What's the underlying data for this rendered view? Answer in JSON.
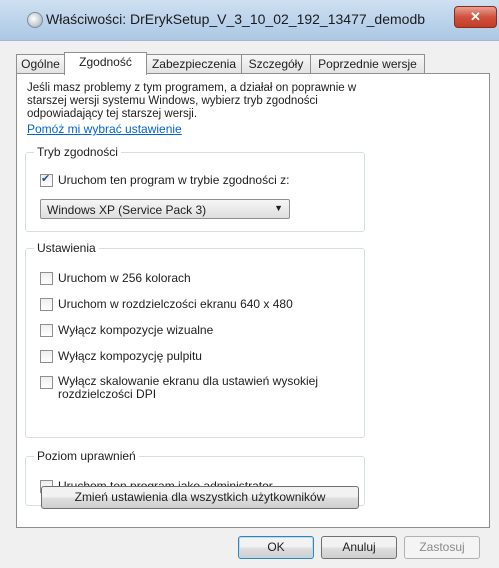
{
  "window": {
    "title": "Właściwości: DrErykSetup_V_3_10_02_192_13477_demodb",
    "close_label": "✕"
  },
  "tabs": [
    {
      "label": "Ogólne"
    },
    {
      "label": "Zgodność"
    },
    {
      "label": "Zabezpieczenia"
    },
    {
      "label": "Szczegóły"
    },
    {
      "label": "Poprzednie wersje"
    }
  ],
  "intro": {
    "text": "Jeśli masz problemy z tym programem, a działał on poprawnie w starszej wersji systemu Windows, wybierz tryb zgodności odpowiadający tej starszej wersji.",
    "help_link": "Pomóż mi wybrać ustawienie"
  },
  "compat_mode": {
    "label": "Tryb zgodności",
    "checkbox": {
      "label": "Uruchom ten program w trybie zgodności z:",
      "checked": true
    },
    "dropdown_value": "Windows XP (Service Pack 3)"
  },
  "settings": {
    "label": "Ustawienia",
    "items": [
      {
        "label": "Uruchom w 256 kolorach",
        "checked": false
      },
      {
        "label": "Uruchom w rozdzielczości ekranu 640 x 480",
        "checked": false
      },
      {
        "label": "Wyłącz kompozycje wizualne",
        "checked": false
      },
      {
        "label": "Wyłącz kompozycję pulpitu",
        "checked": false
      },
      {
        "label": "Wyłącz skalowanie ekranu dla ustawień wysokiej rozdzielczości DPI",
        "checked": false
      }
    ]
  },
  "privilege": {
    "label": "Poziom uprawnień",
    "checkbox": {
      "label": "Uruchom ten program jako administrator",
      "checked": false
    }
  },
  "all_users_button": "Zmień ustawienia dla wszystkich użytkowników",
  "buttons": {
    "ok": "OK",
    "cancel": "Anuluj",
    "apply": "Zastosuj"
  }
}
